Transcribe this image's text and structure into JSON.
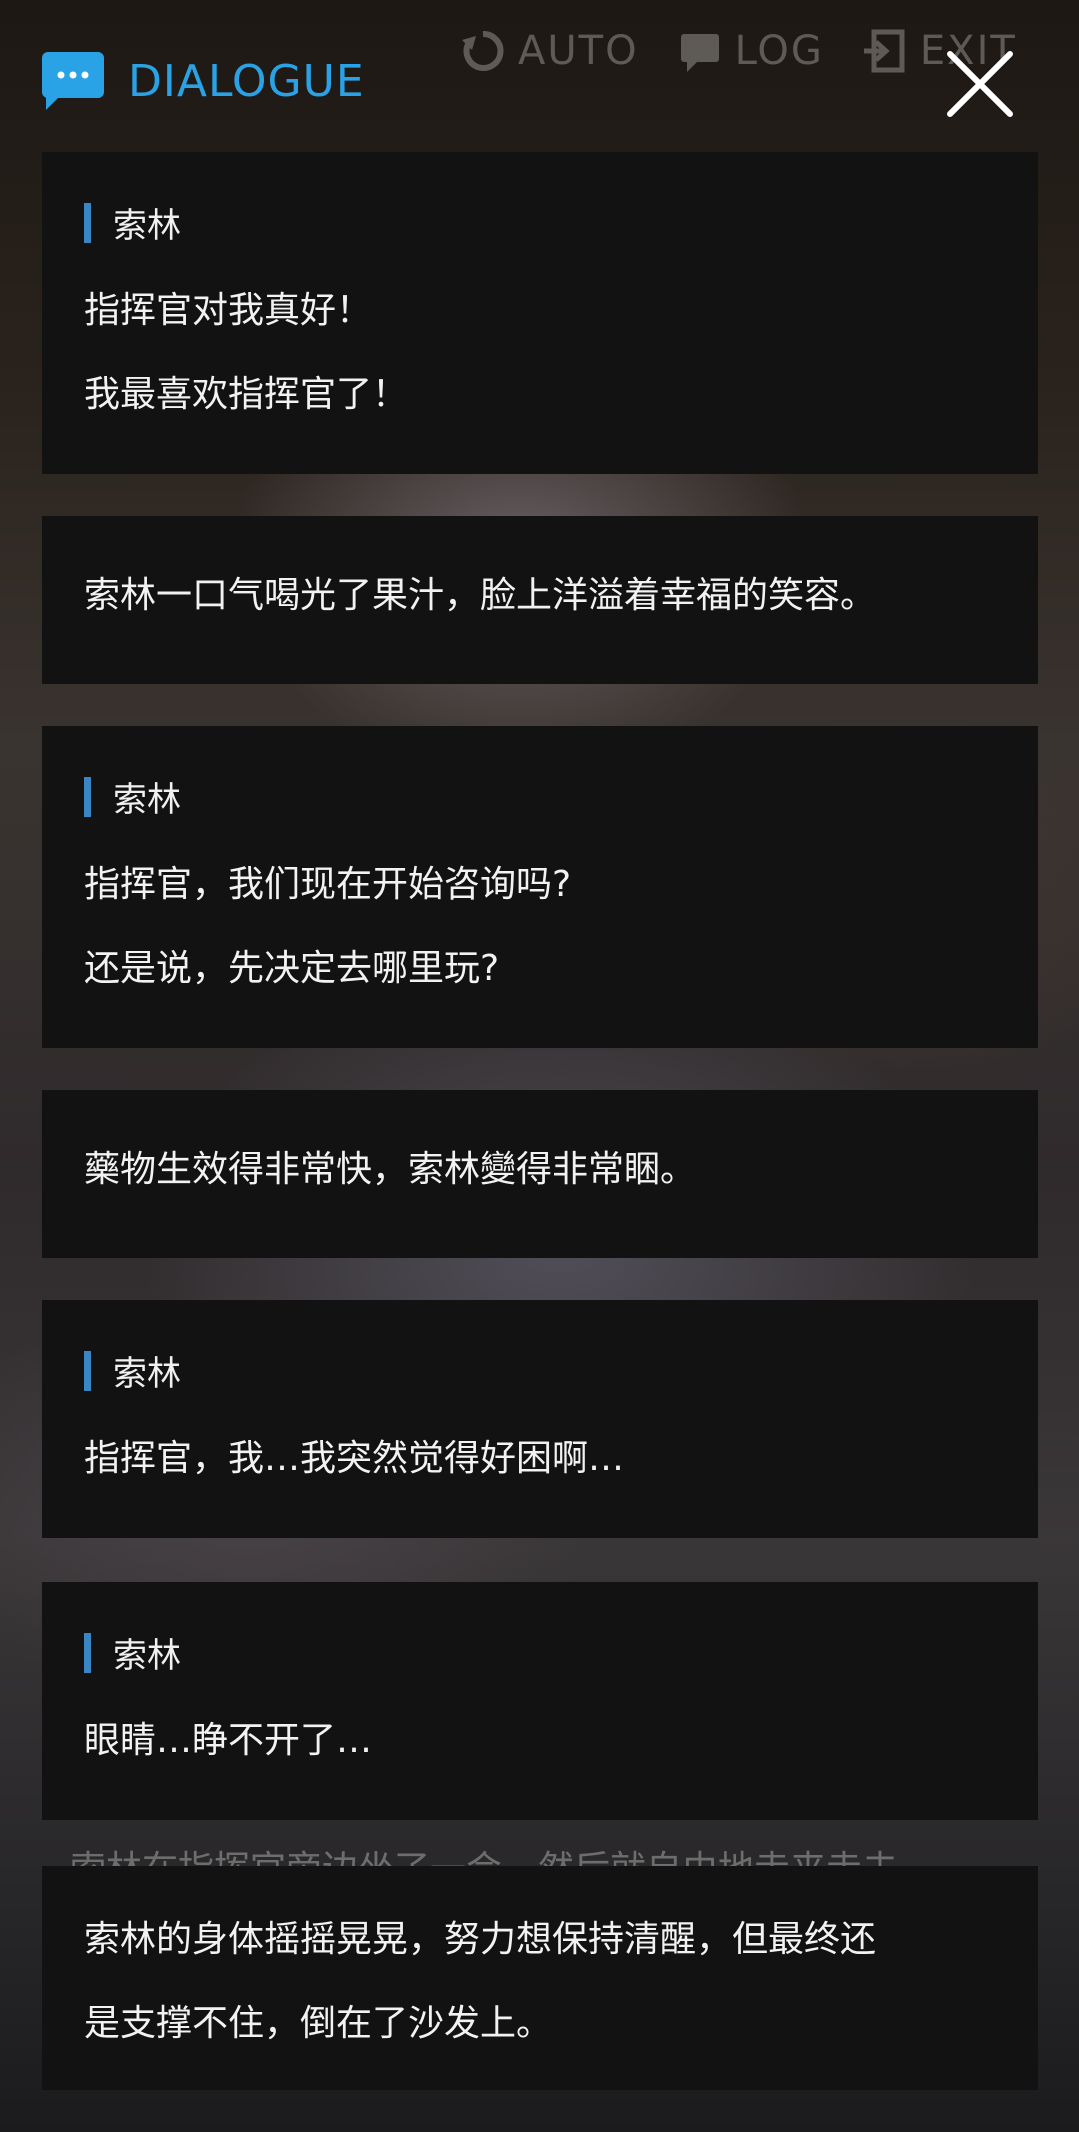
{
  "header": {
    "title": "DIALOGUE"
  },
  "background_hud": {
    "auto_label": "AUTO",
    "log_label": "LOG",
    "exit_label": "EXIT"
  },
  "background_text": "索林在指挥官旁边坐了一会，然后就自由地走来走去……",
  "entries": [
    {
      "speaker": "索林",
      "lines": [
        "指挥官对我真好！",
        "我最喜欢指挥官了！"
      ]
    },
    {
      "speaker": "",
      "lines": [
        "索林一口气喝光了果汁，脸上洋溢着幸福的笑容。"
      ]
    },
    {
      "speaker": "索林",
      "lines": [
        "指挥官，我们现在开始咨询吗?",
        "还是说，先决定去哪里玩?"
      ]
    },
    {
      "speaker": "",
      "lines": [
        "藥物生效得非常快，索林變得非常睏。"
      ]
    },
    {
      "speaker": "索林",
      "lines": [
        "指挥官，我…我突然觉得好困啊…"
      ]
    },
    {
      "speaker": "索林",
      "lines": [
        "眼睛…睁不开了…"
      ]
    },
    {
      "speaker": "",
      "lines": [
        "索林的身体摇摇晃晃，努力想保持清醒，但最终还",
        "是支撑不住，倒在了沙发上。"
      ]
    }
  ],
  "colors": {
    "accent": "#2aa3e6",
    "speaker_bar": "#3a86c4",
    "card": "#121212"
  },
  "icons": {
    "header": "chat-bubble-icon",
    "close": "close-icon"
  }
}
